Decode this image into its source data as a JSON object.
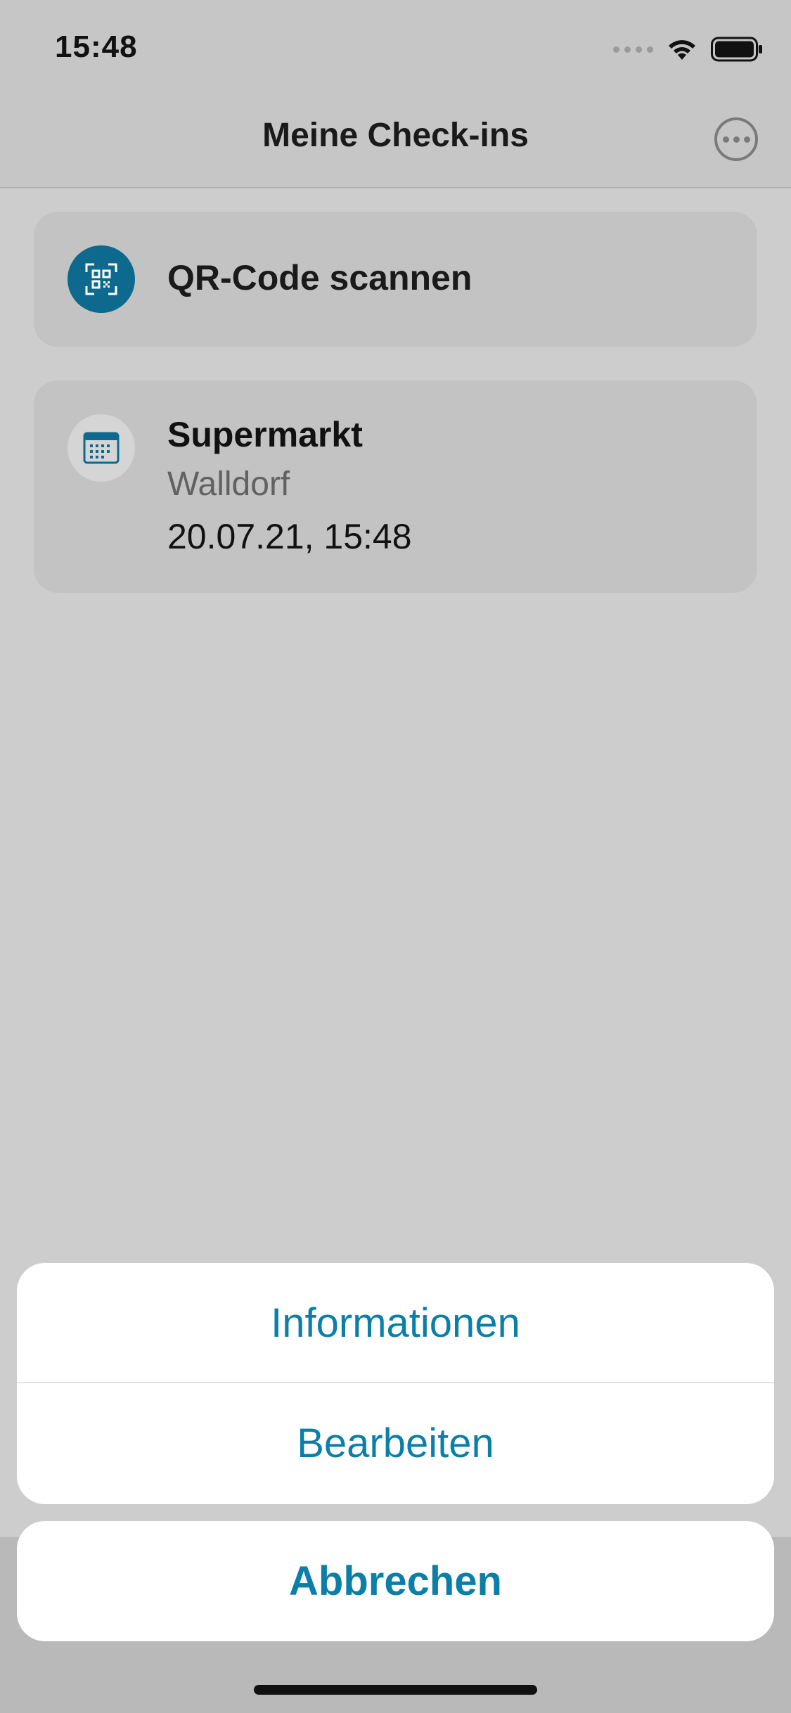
{
  "status_bar": {
    "time": "15:48"
  },
  "nav": {
    "title": "Meine Check-ins",
    "more_icon": "ellipsis-circle-icon"
  },
  "scan_card": {
    "label": "QR-Code scannen",
    "icon": "qr-scan-icon",
    "icon_color": "#0d6a8e"
  },
  "checkin_card": {
    "title": "Supermarkt",
    "location": "Walldorf",
    "datetime": "20.07.21, 15:48",
    "icon": "calendar-icon"
  },
  "action_sheet": {
    "items": [
      "Informationen",
      "Bearbeiten"
    ],
    "cancel": "Abbrechen",
    "accent": "#0b7fa8"
  }
}
